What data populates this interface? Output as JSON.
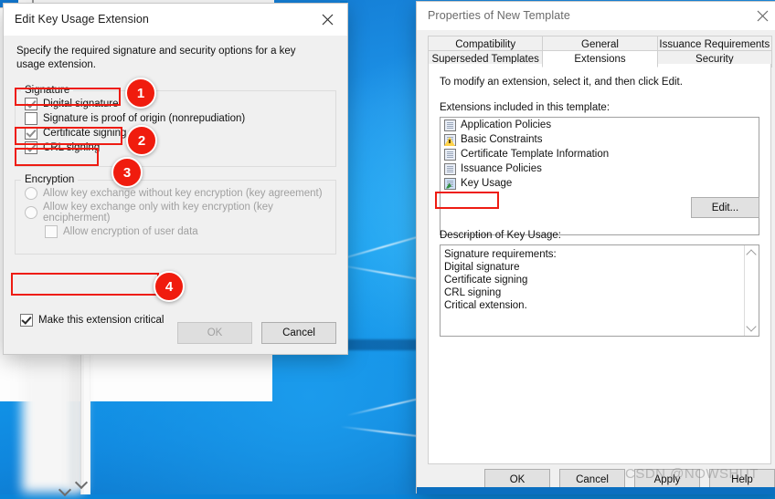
{
  "desktop": {
    "wallpaper_name": "windows-10-blue-wallpaper"
  },
  "left_dialog": {
    "title": "Edit Key Usage Extension",
    "close_icon": "close-icon",
    "intro": "Specify the required signature and security options for a key usage extension.",
    "signature_group": {
      "legend": "Signature",
      "items": [
        {
          "label": "Digital signature",
          "checked": true,
          "disabled": false
        },
        {
          "label": "Signature is proof of origin (nonrepudiation)",
          "checked": false,
          "disabled": false
        },
        {
          "label": "Certificate signing",
          "checked": true,
          "disabled": false
        },
        {
          "label": "CRL signing",
          "checked": true,
          "disabled": false
        }
      ]
    },
    "encryption_group": {
      "legend": "Encryption",
      "items": [
        {
          "label": "Allow key exchange without key encryption (key agreement)",
          "type": "radio",
          "checked": false,
          "disabled": true
        },
        {
          "label": "Allow key exchange only with key encryption (key encipherment)",
          "type": "radio",
          "checked": false,
          "disabled": true
        },
        {
          "label": "Allow encryption of user data",
          "type": "checkbox",
          "checked": false,
          "disabled": true
        }
      ]
    },
    "critical_checkbox": {
      "label": "Make this extension critical",
      "checked": true
    },
    "buttons": {
      "ok": "OK",
      "ok_disabled": true,
      "cancel": "Cancel"
    }
  },
  "annotations": {
    "badges": [
      {
        "number": "1",
        "target": "Digital signature"
      },
      {
        "number": "2",
        "target": "Certificate signing"
      },
      {
        "number": "3",
        "target": "CRL signing"
      },
      {
        "number": "4",
        "target": "Make this extension critical"
      }
    ],
    "color": "#f01c0e"
  },
  "right_dialog": {
    "title": "Properties of New Template",
    "close_icon": "close-icon",
    "tabs_row1": [
      {
        "label": "Compatibility",
        "active": false
      },
      {
        "label": "General",
        "active": false
      },
      {
        "label": "Issuance Requirements",
        "active": false
      }
    ],
    "tabs_row2": [
      {
        "label": "Superseded Templates",
        "active": false
      },
      {
        "label": "Extensions",
        "active": true
      },
      {
        "label": "Security",
        "active": false
      }
    ],
    "instruction": "To modify an extension, select it, and then click Edit.",
    "list_label": "Extensions included in this template:",
    "extensions": [
      {
        "label": "Application Policies",
        "icon": "certificate-sheet-icon",
        "selected": false
      },
      {
        "label": "Basic Constraints",
        "icon": "warning-triangle-icon",
        "selected": false
      },
      {
        "label": "Certificate Template Information",
        "icon": "certificate-sheet-icon",
        "selected": false
      },
      {
        "label": "Issuance Policies",
        "icon": "certificate-sheet-icon",
        "selected": false
      },
      {
        "label": "Key Usage",
        "icon": "key-usage-icon",
        "selected": true
      }
    ],
    "edit_button": "Edit...",
    "description_label": "Description of Key Usage:",
    "description_lines": [
      "Signature requirements:",
      "Digital signature",
      "Certificate signing",
      "CRL signing",
      "Critical extension."
    ],
    "scroll_up_icon": "chevron-up-icon",
    "scroll_down_icon": "chevron-down-icon",
    "buttons": {
      "ok": "OK",
      "cancel": "Cancel",
      "apply": "Apply",
      "help": "Help"
    }
  },
  "watermark": {
    "text": "CSDN @NOWSHUT"
  }
}
